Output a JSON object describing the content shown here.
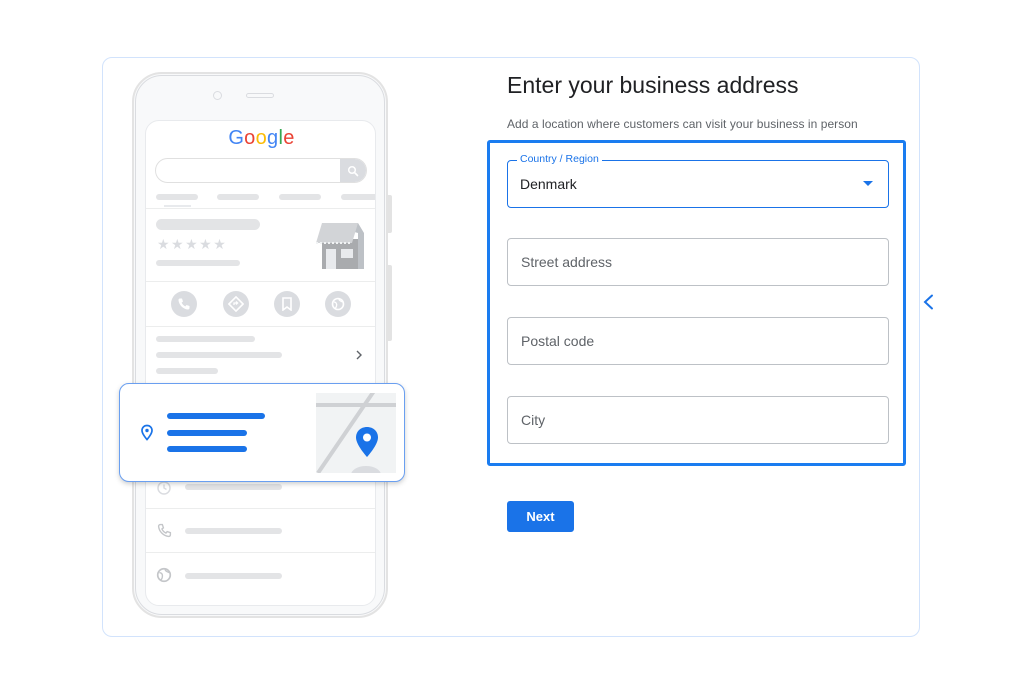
{
  "page": {
    "heading": "Enter your business address",
    "subtitle": "Add a location where customers can visit your business in person"
  },
  "form": {
    "country": {
      "label": "Country / Region",
      "value": "Denmark"
    },
    "street": {
      "placeholder": "Street address",
      "value": ""
    },
    "postal": {
      "placeholder": "Postal code",
      "value": ""
    },
    "city": {
      "placeholder": "City",
      "value": ""
    },
    "next_label": "Next"
  },
  "illustration": {
    "logo": [
      {
        "char": "G",
        "color": "#4285f4"
      },
      {
        "char": "o",
        "color": "#ea4335"
      },
      {
        "char": "o",
        "color": "#fbbc05"
      },
      {
        "char": "g",
        "color": "#4285f4"
      },
      {
        "char": "l",
        "color": "#34a853"
      },
      {
        "char": "e",
        "color": "#ea4335"
      }
    ],
    "rating_stars": "★★★★★",
    "action_icons": [
      "phone-icon",
      "directions-icon",
      "bookmark-icon",
      "globe-icon"
    ],
    "detail_icons": [
      "clock-icon",
      "phone-icon",
      "globe-icon"
    ]
  },
  "colors": {
    "accent": "#1a73e8",
    "card_border": "#d2e3fc",
    "field_border": "#bdc1c6",
    "muted_text": "#5f6368",
    "heading_text": "#202124",
    "placeholder_gray": "#dadce0"
  }
}
